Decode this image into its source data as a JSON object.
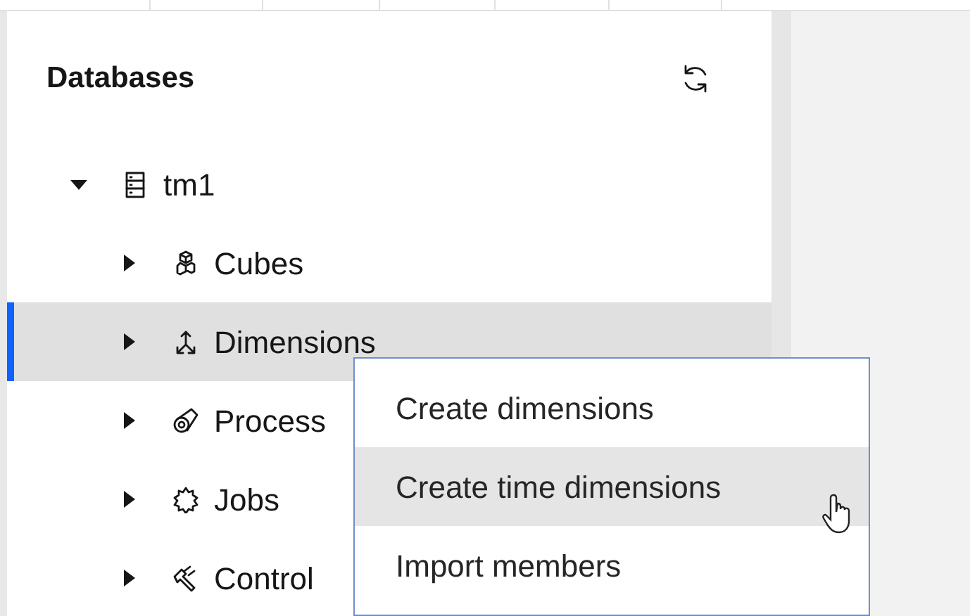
{
  "panel": {
    "title": "Databases"
  },
  "tree": [
    {
      "label": "tm1",
      "kind": "server",
      "expanded": true,
      "selected": false,
      "children": [
        {
          "label": "Cubes",
          "kind": "cubes",
          "expanded": false,
          "selected": false
        },
        {
          "label": "Dimensions",
          "kind": "dimensions",
          "expanded": false,
          "selected": true
        },
        {
          "label": "Process",
          "kind": "processes",
          "expanded": false,
          "selected": false
        },
        {
          "label": "Jobs",
          "kind": "jobs",
          "expanded": false,
          "selected": false
        },
        {
          "label": "Control",
          "kind": "control",
          "expanded": false,
          "selected": false
        }
      ]
    }
  ],
  "context_menu": {
    "items": [
      {
        "label": "Create dimensions",
        "selected": false
      },
      {
        "label": "Create time dimensions",
        "selected": true
      },
      {
        "label": "Import members",
        "selected": false
      }
    ]
  }
}
